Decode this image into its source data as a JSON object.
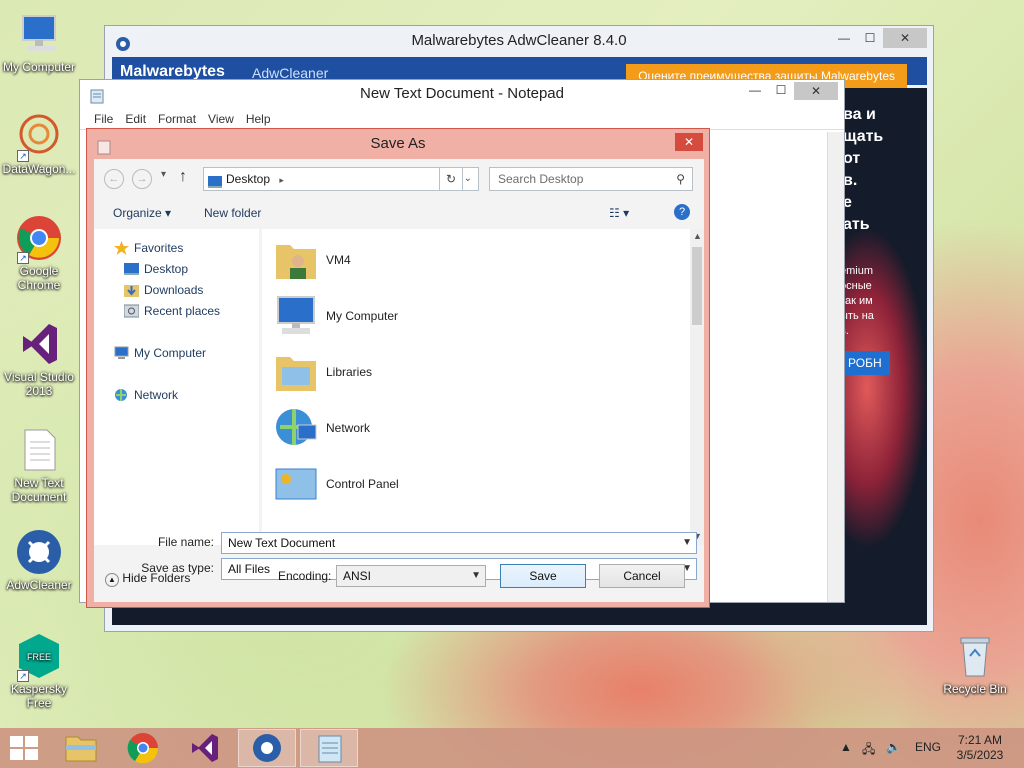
{
  "desktop": {
    "icons": [
      {
        "label": "My Computer"
      },
      {
        "label": "DataWagon..."
      },
      {
        "label": "Google Chrome"
      },
      {
        "label": "Visual Studio 2013"
      },
      {
        "label": "New Text Document"
      },
      {
        "label": "AdwCleaner"
      },
      {
        "label": "Kaspersky Free"
      },
      {
        "label": "Recycle Bin"
      }
    ]
  },
  "adwcleaner": {
    "title": "Malwarebytes AdwCleaner 8.4.0",
    "brand": "Malwarebytes",
    "brand_product": "AdwCleaner",
    "promo": "Оцените преимущества защиты Malwarebytes",
    "side_lines": [
      "ва и",
      "щать",
      "от",
      "в.",
      "е",
      "ать"
    ],
    "side_small": [
      "emium",
      "осные",
      "как им",
      "ыть на",
      "в."
    ],
    "side_button": "РОБН"
  },
  "notepad": {
    "title": "New Text Document - Notepad",
    "menu": [
      "File",
      "Edit",
      "Format",
      "View",
      "Help"
    ]
  },
  "saveas": {
    "title": "Save As",
    "address": "Desktop",
    "search_placeholder": "Search Desktop",
    "toolbar": {
      "organize": "Organize",
      "new_folder": "New folder"
    },
    "nav": {
      "favorites": "Favorites",
      "desktop": "Desktop",
      "downloads": "Downloads",
      "recent": "Recent places",
      "my_computer": "My Computer",
      "network": "Network"
    },
    "files": [
      "VM4",
      "My Computer",
      "Libraries",
      "Network",
      "Control Panel"
    ],
    "file_name_label": "File name:",
    "file_name_value": "New Text Document",
    "save_type_label": "Save as type:",
    "save_type_value": "All Files",
    "hide_folders": "Hide Folders",
    "encoding_label": "Encoding:",
    "encoding_value": "ANSI",
    "save_button": "Save",
    "cancel_button": "Cancel"
  },
  "taskbar": {
    "lang": "ENG",
    "time": "7:21 AM",
    "date": "3/5/2023"
  }
}
